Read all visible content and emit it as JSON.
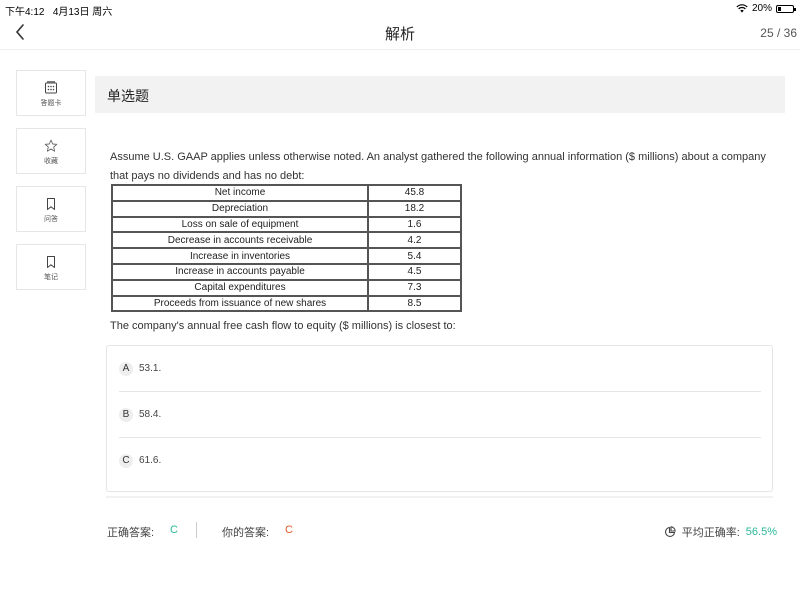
{
  "status": {
    "time": "下午4:12",
    "date": "4月13日 周六",
    "battery": "20%",
    "battery_level": 0.2
  },
  "nav": {
    "title": "解析",
    "counter": "25 / 36"
  },
  "sidebar": {
    "items": [
      {
        "label": "答题卡",
        "icon": "answer-card-icon"
      },
      {
        "label": "收藏",
        "icon": "star-icon"
      },
      {
        "label": "问答",
        "icon": "bookmark-icon"
      },
      {
        "label": "笔记",
        "icon": "bookmark-icon"
      }
    ]
  },
  "section": {
    "title": "单选题"
  },
  "question": {
    "text": "Assume U.S. GAAP applies unless otherwise noted. An analyst gathered the following annual information ($ millions) about a company that pays no dividends and has no debt:",
    "table": [
      {
        "label": "Net income",
        "value": "45.8"
      },
      {
        "label": "Depreciation",
        "value": "18.2"
      },
      {
        "label": "Loss on sale of equipment",
        "value": "1.6"
      },
      {
        "label": "Decrease in accounts receivable",
        "value": "4.2"
      },
      {
        "label": "Increase in inventories",
        "value": "5.4"
      },
      {
        "label": "Increase in accounts payable",
        "value": "4.5"
      },
      {
        "label": "Capital expenditures",
        "value": "7.3"
      },
      {
        "label": "Proceeds from issuance of new shares",
        "value": "8.5"
      }
    ],
    "prompt": "The company's annual free cash flow to equity ($ millions) is closest to:"
  },
  "options": [
    {
      "letter": "A",
      "text": "53.1."
    },
    {
      "letter": "B",
      "text": "58.4."
    },
    {
      "letter": "C",
      "text": "61.6."
    }
  ],
  "result": {
    "correct_label": "正确答案:",
    "correct_value": "C",
    "mine_label": "你的答案:",
    "mine_value": "C",
    "avg_label": "平均正确率:",
    "avg_value": "56.5%"
  },
  "colors": {
    "correct": "#2bb89a",
    "mine": "#e0582a"
  }
}
